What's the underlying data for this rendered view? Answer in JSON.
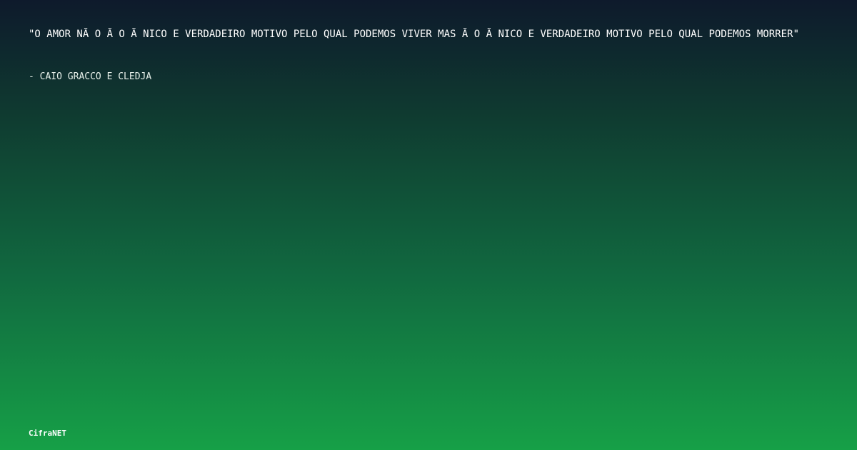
{
  "quote": {
    "text": "\"O AMOR NÃ O Ã  O Ã NICO E VERDADEIRO MOTIVO PELO QUAL PODEMOS VIVER MAS Ã  O Ã NICO E VERDADEIRO MOTIVO PELO QUAL PODEMOS MORRER\""
  },
  "author": {
    "text": "- CAIO GRACCO E CLEDJA"
  },
  "brand": {
    "name": "CifraNET"
  },
  "colors": {
    "background_top": "#0e1a2c",
    "background_bottom": "#16a047",
    "text": "#ffffff"
  }
}
